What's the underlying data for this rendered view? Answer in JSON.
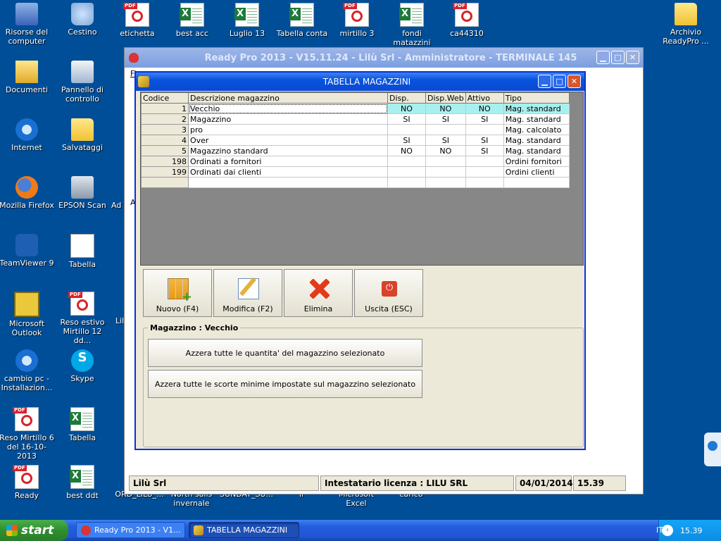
{
  "desktop": {
    "icons": [
      {
        "label": "Risorse del computer",
        "icon": "computer-icon"
      },
      {
        "label": "Cestino",
        "icon": "recycle-bin-icon"
      },
      {
        "label": "etichetta",
        "icon": "pdf-icon"
      },
      {
        "label": "best acc",
        "icon": "excel-icon"
      },
      {
        "label": "Luglio 13",
        "icon": "excel-icon"
      },
      {
        "label": "Tabella conta",
        "icon": "excel-icon"
      },
      {
        "label": "mirtillo 3",
        "icon": "pdf-icon"
      },
      {
        "label": "fondi matazzini",
        "icon": "excel-icon"
      },
      {
        "label": "ca44310",
        "icon": "pdf-icon"
      },
      {
        "label": "Archivio ReadyPro ...",
        "icon": "folder-icon"
      },
      {
        "label": "Documenti",
        "icon": "documents-icon"
      },
      {
        "label": "Pannello di controllo",
        "icon": "control-panel-icon"
      },
      {
        "label": "Internet",
        "icon": "internet-explorer-icon"
      },
      {
        "label": "Salvataggi",
        "icon": "folder-icon"
      },
      {
        "label": "Mozilla Firefox",
        "icon": "firefox-icon"
      },
      {
        "label": "EPSON Scan",
        "icon": "scanner-icon"
      },
      {
        "label": "Ad",
        "icon": ""
      },
      {
        "label": "TeamViewer 9",
        "icon": "teamviewer-icon"
      },
      {
        "label": "Tabella",
        "icon": "text-document-icon"
      },
      {
        "label": "Microsoft Outlook",
        "icon": "outlook-icon"
      },
      {
        "label": "Reso estivo Mirtillo 12 dd...",
        "icon": "pdf-icon"
      },
      {
        "label": "Lil",
        "icon": ""
      },
      {
        "label": "cambio pc - Installazion...",
        "icon": "internet-explorer-icon"
      },
      {
        "label": "Skype",
        "icon": "skype-icon"
      },
      {
        "label": "Reso Mirtillo 6 del 16-10-2013",
        "icon": "pdf-icon"
      },
      {
        "label": "Tabella",
        "icon": "excel-icon"
      },
      {
        "label": "Ready",
        "icon": "pdf-icon"
      },
      {
        "label": "best ddt",
        "icon": "excel-icon"
      },
      {
        "label": "ORD_LILU_...",
        "icon": ""
      },
      {
        "label": "North sails invernale",
        "icon": ""
      },
      {
        "label": "SUNDAY_SU...",
        "icon": ""
      },
      {
        "label": "il",
        "icon": ""
      },
      {
        "label": "Microsoft Excel",
        "icon": ""
      },
      {
        "label": "carico",
        "icon": ""
      }
    ]
  },
  "main_window": {
    "title": "Ready Pro 2013 - V15.11.24 - Lilù Srl - Amministratore - TERMINALE 145",
    "menu_fragment": "Fi",
    "side_fragment": "A",
    "status": {
      "company": "Lilù Srl",
      "license": "Intestatario licenza : LILU SRL",
      "date": "04/01/2014",
      "time": "15.39"
    }
  },
  "child_window": {
    "title": "TABELLA MAGAZZINI",
    "columns": [
      "Codice",
      "Descrizione magazzino",
      "Disp.",
      "Disp.Web",
      "Attivo",
      "Tipo"
    ],
    "rows": [
      {
        "codice": "1",
        "descrizione": "Vecchio",
        "disp": "NO",
        "disp_web": "NO",
        "attivo": "NO",
        "tipo": "Mag. standard"
      },
      {
        "codice": "2",
        "descrizione": "Magazzino",
        "disp": "SI",
        "disp_web": "SI",
        "attivo": "SI",
        "tipo": "Mag. standard"
      },
      {
        "codice": "3",
        "descrizione": "pro",
        "disp": "",
        "disp_web": "",
        "attivo": "",
        "tipo": "Mag. calcolato"
      },
      {
        "codice": "4",
        "descrizione": "Over",
        "disp": "SI",
        "disp_web": "SI",
        "attivo": "SI",
        "tipo": "Mag. standard"
      },
      {
        "codice": "5",
        "descrizione": "Magazzino standard",
        "disp": "NO",
        "disp_web": "NO",
        "attivo": "SI",
        "tipo": "Mag. standard"
      },
      {
        "codice": "198",
        "descrizione": "Ordinati a fornitori",
        "disp": "",
        "disp_web": "",
        "attivo": "",
        "tipo": "Ordini fornitori"
      },
      {
        "codice": "199",
        "descrizione": "Ordinati dai clienti",
        "disp": "",
        "disp_web": "",
        "attivo": "",
        "tipo": "Ordini clienti"
      }
    ],
    "buttons": {
      "new": "Nuovo (F4)",
      "edit": "Modifica (F2)",
      "delete": "Elimina",
      "exit": "Uscita (ESC)"
    },
    "group": {
      "legend": "Magazzino : Vecchio",
      "reset_qty": "Azzera tutte le quantita' del magazzino selezionato",
      "reset_stock": "Azzera tutte le scorte minime impostate sul magazzino selezionato"
    }
  },
  "taskbar": {
    "start": "start",
    "tasks": [
      {
        "label": "Ready Pro 2013 - V1...",
        "icon": "ready-pro-icon"
      },
      {
        "label": "TABELLA MAGAZZINI",
        "icon": "warehouse-icon"
      }
    ],
    "language": "IT",
    "clock": "15.39"
  }
}
